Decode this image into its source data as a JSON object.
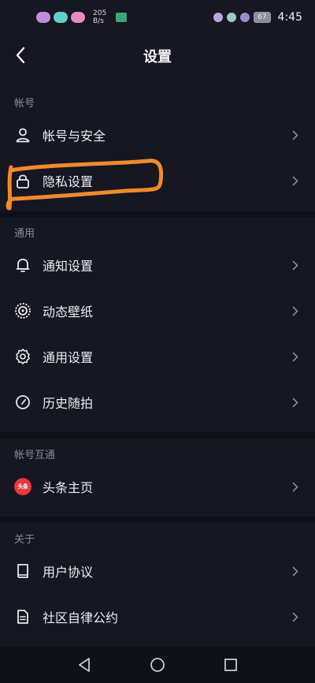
{
  "status_bar": {
    "net_speed_value": "205",
    "net_speed_unit": "B/s",
    "battery": "67",
    "time": "4:45"
  },
  "header": {
    "title": "设置"
  },
  "sections": {
    "account": {
      "label": "帐号",
      "items": [
        {
          "label": "帐号与安全",
          "icon": "person-icon"
        },
        {
          "label": "隐私设置",
          "icon": "lock-icon"
        }
      ]
    },
    "general": {
      "label": "通用",
      "items": [
        {
          "label": "通知设置",
          "icon": "bell-icon"
        },
        {
          "label": "动态壁纸",
          "icon": "live-wallpaper-icon"
        },
        {
          "label": "通用设置",
          "icon": "gear-icon"
        },
        {
          "label": "历史随拍",
          "icon": "clock-icon"
        }
      ]
    },
    "interop": {
      "label": "帐号互通",
      "items": [
        {
          "label": "头条主页",
          "icon": "toutiao-logo-icon",
          "badge": "头条"
        }
      ]
    },
    "about": {
      "label": "关于",
      "items": [
        {
          "label": "用户协议",
          "icon": "book-icon"
        },
        {
          "label": "社区自律公约",
          "icon": "document-icon"
        }
      ]
    }
  },
  "colors": {
    "background": "#161722",
    "highlight": "#f08a2c",
    "toutiao_red": "#e8373d"
  }
}
